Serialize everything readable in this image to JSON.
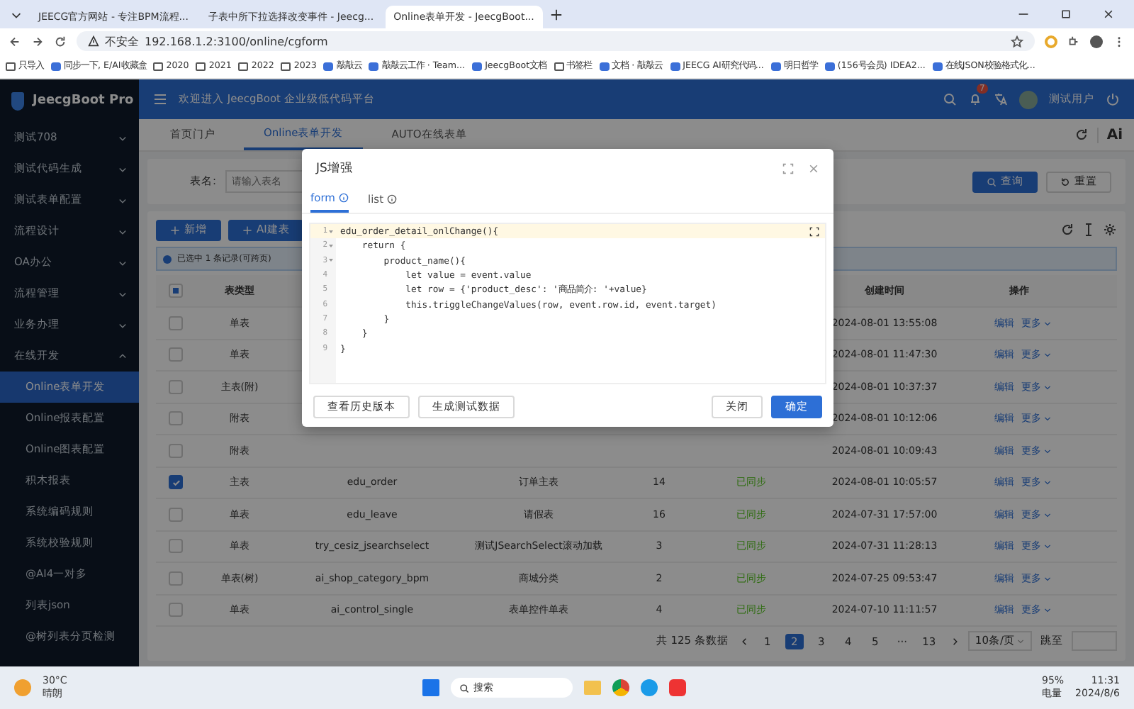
{
  "browser": {
    "tabs": [
      {
        "title": "JEECG官方网站 - 专注BPM流程...",
        "selected": false
      },
      {
        "title": "子表中所下拉选择改变事件 - Jeecg...",
        "selected": false
      },
      {
        "title": "Online表单开发 - JeecgBoot...",
        "selected": true
      }
    ],
    "security": "不安全",
    "url": "192.168.1.2:3100/online/cgform",
    "bookmarks": [
      {
        "label": "只导入",
        "kind": "folder"
      },
      {
        "label": "同步一下, E/AI收藏盒",
        "kind": "page"
      },
      {
        "label": "2020",
        "kind": "folder"
      },
      {
        "label": "2021",
        "kind": "folder"
      },
      {
        "label": "2022",
        "kind": "folder"
      },
      {
        "label": "2023",
        "kind": "folder"
      },
      {
        "label": "敲敲云",
        "kind": "page"
      },
      {
        "label": "敲敲云工作 · Team...",
        "kind": "page"
      },
      {
        "label": "JeecgBoot文档",
        "kind": "page"
      },
      {
        "label": "书签栏",
        "kind": "folder"
      },
      {
        "label": "文档 · 敲敲云",
        "kind": "page"
      },
      {
        "label": "JEECG AI研究代码...",
        "kind": "page"
      },
      {
        "label": "明日哲学",
        "kind": "page"
      },
      {
        "label": "(156号会员) IDEA2...",
        "kind": "page"
      },
      {
        "label": "在线JSON校验格式化...",
        "kind": "page"
      }
    ]
  },
  "app": {
    "logo": "JeecgBoot Pro",
    "welcome": "欢迎进入 JeecgBoot 企业级低代码平台",
    "notification_count": "7",
    "user": "测试用户",
    "ai_label": "Ai",
    "sidebar": [
      {
        "label": "测试708",
        "expanded": false
      },
      {
        "label": "测试代码生成",
        "expanded": false
      },
      {
        "label": "测试表单配置",
        "expanded": false
      },
      {
        "label": "流程设计",
        "expanded": false
      },
      {
        "label": "OA办公",
        "expanded": false
      },
      {
        "label": "流程管理",
        "expanded": false
      },
      {
        "label": "业务办理",
        "expanded": false
      },
      {
        "label": "在线开发",
        "expanded": true,
        "children": [
          {
            "label": "Online表单开发",
            "selected": true
          },
          {
            "label": "Online报表配置",
            "selected": false
          },
          {
            "label": "Online图表配置",
            "selected": false
          },
          {
            "label": "积木报表",
            "selected": false
          },
          {
            "label": "系统编码规则",
            "selected": false
          },
          {
            "label": "系统校验规则",
            "selected": false
          },
          {
            "label": "@AI4一对多",
            "selected": false
          },
          {
            "label": "列表json",
            "selected": false
          },
          {
            "label": "@树列表分页检测",
            "selected": false
          }
        ]
      }
    ],
    "tabs": [
      {
        "label": "首页门户",
        "selected": false
      },
      {
        "label": "Online表单开发",
        "selected": true
      },
      {
        "label": "AUTO在线表单",
        "selected": false
      }
    ],
    "search": {
      "label": "表名:",
      "placeholder": "请输入表名",
      "query": "查询",
      "reset": "重置"
    },
    "toolbar": [
      "新增",
      "AI建表"
    ],
    "alert": {
      "text": "已选中 1 条记录(可跨页)"
    },
    "select_all_indeterminate": true,
    "columns": {
      "type": "表类型",
      "created": "创建时间",
      "actions": "操作"
    },
    "rows": [
      {
        "checked": false,
        "type": "单表",
        "created": "2024-08-01 13:55:08",
        "actions": [
          "编辑",
          "更多"
        ]
      },
      {
        "checked": false,
        "type": "单表",
        "created": "2024-08-01 11:47:30",
        "actions": [
          "编辑",
          "更多"
        ]
      },
      {
        "checked": false,
        "type": "主表(附)",
        "created": "2024-08-01 10:37:37",
        "actions": [
          "编辑",
          "更多"
        ]
      },
      {
        "checked": false,
        "type": "附表",
        "created": "2024-08-01 10:12:06",
        "actions": [
          "编辑",
          "更多"
        ]
      },
      {
        "checked": false,
        "type": "附表",
        "created": "2024-08-01 10:09:43",
        "actions": [
          "编辑",
          "更多"
        ]
      },
      {
        "checked": true,
        "type": "主表",
        "name": "edu_order",
        "desc": "订单主表",
        "version": "14",
        "status": "已同步",
        "created": "2024-08-01 10:05:57",
        "actions": [
          "编辑",
          "更多"
        ]
      },
      {
        "checked": false,
        "type": "单表",
        "name": "edu_leave",
        "desc": "请假表",
        "version": "16",
        "status": "已同步",
        "created": "2024-07-31 17:57:00",
        "actions": [
          "编辑",
          "更多"
        ]
      },
      {
        "checked": false,
        "type": "单表",
        "name": "try_cesiz_jsearchselect",
        "desc": "测试JSearchSelect滚动加载",
        "version": "3",
        "status": "已同步",
        "created": "2024-07-31 11:28:13",
        "actions": [
          "编辑",
          "更多"
        ]
      },
      {
        "checked": false,
        "type": "单表(树)",
        "name": "ai_shop_category_bpm",
        "desc": "商城分类",
        "version": "2",
        "status": "已同步",
        "created": "2024-07-25 09:53:47",
        "actions": [
          "编辑",
          "更多"
        ]
      },
      {
        "checked": false,
        "type": "单表",
        "name": "ai_control_single",
        "desc": "表单控件单表",
        "version": "4",
        "status": "已同步",
        "created": "2024-07-10 11:11:57",
        "actions": [
          "编辑",
          "更多"
        ]
      }
    ],
    "pagination": {
      "total": "共 125 条数据",
      "pages": [
        {
          "label": "1",
          "selected": false
        },
        {
          "label": "2",
          "selected": true
        },
        {
          "label": "3",
          "selected": false
        },
        {
          "label": "4",
          "selected": false
        },
        {
          "label": "5",
          "selected": false
        },
        {
          "label": "···",
          "selected": false
        },
        {
          "label": "13",
          "selected": false
        }
      ],
      "size": "10条/页",
      "jump": "跳至"
    }
  },
  "modal": {
    "title": "JS增强",
    "tabs": [
      {
        "label": "form",
        "selected": true
      },
      {
        "label": "list",
        "selected": false
      }
    ],
    "code": [
      {
        "no": "1",
        "text": "edu_order_detail_onlChange(){",
        "active": true,
        "fold": true
      },
      {
        "no": "2",
        "text": "    return {",
        "active": false,
        "fold": true
      },
      {
        "no": "3",
        "text": "        product_name(){",
        "active": false,
        "fold": true
      },
      {
        "no": "4",
        "text": "            let value = event.value",
        "active": false,
        "fold": false
      },
      {
        "no": "5",
        "text": "            let row = {'product_desc': '商品简介: '+value}",
        "active": false,
        "fold": false
      },
      {
        "no": "6",
        "text": "            this.triggleChangeValues(row, event.row.id, event.target)",
        "active": false,
        "fold": false
      },
      {
        "no": "7",
        "text": "        }",
        "active": false,
        "fold": false
      },
      {
        "no": "8",
        "text": "    }",
        "active": false,
        "fold": false
      },
      {
        "no": "9",
        "text": "}",
        "active": false,
        "fold": false
      }
    ],
    "buttons": [
      {
        "label": "查看历史版本",
        "kind": "default"
      },
      {
        "label": "生成测试数据",
        "kind": "default"
      },
      {
        "label": "关闭",
        "kind": "default"
      },
      {
        "label": "确定",
        "kind": "primary"
      }
    ]
  },
  "taskbar": {
    "temperature": "30°C",
    "weather": "晴朗",
    "search": "搜索",
    "battery": "95%",
    "battery_label": "电量",
    "time": "11:31",
    "date": "2024/8/6"
  }
}
